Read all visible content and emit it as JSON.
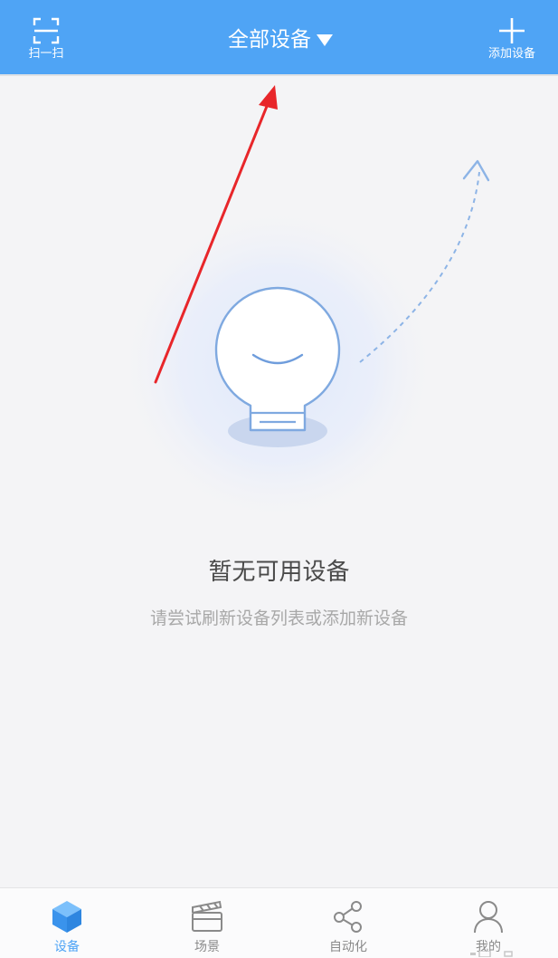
{
  "header": {
    "scan_label": "扫一扫",
    "title": "全部设备",
    "add_label": "添加设备",
    "background_color": "#4fa4f5"
  },
  "empty_state": {
    "title": "暂无可用设备",
    "subtitle": "请尝试刷新设备列表或添加新设备"
  },
  "tabbar": {
    "tabs": [
      {
        "label": "设备",
        "icon": "cube-icon",
        "active": true
      },
      {
        "label": "场景",
        "icon": "clapperboard-icon",
        "active": false
      },
      {
        "label": "自动化",
        "icon": "share-nodes-icon",
        "active": false
      },
      {
        "label": "我的",
        "icon": "user-icon",
        "active": false
      }
    ],
    "active_color": "#4fa4f5",
    "inactive_color": "#8a8a8a"
  },
  "annotation": {
    "arrow_color": "#e8262a"
  }
}
